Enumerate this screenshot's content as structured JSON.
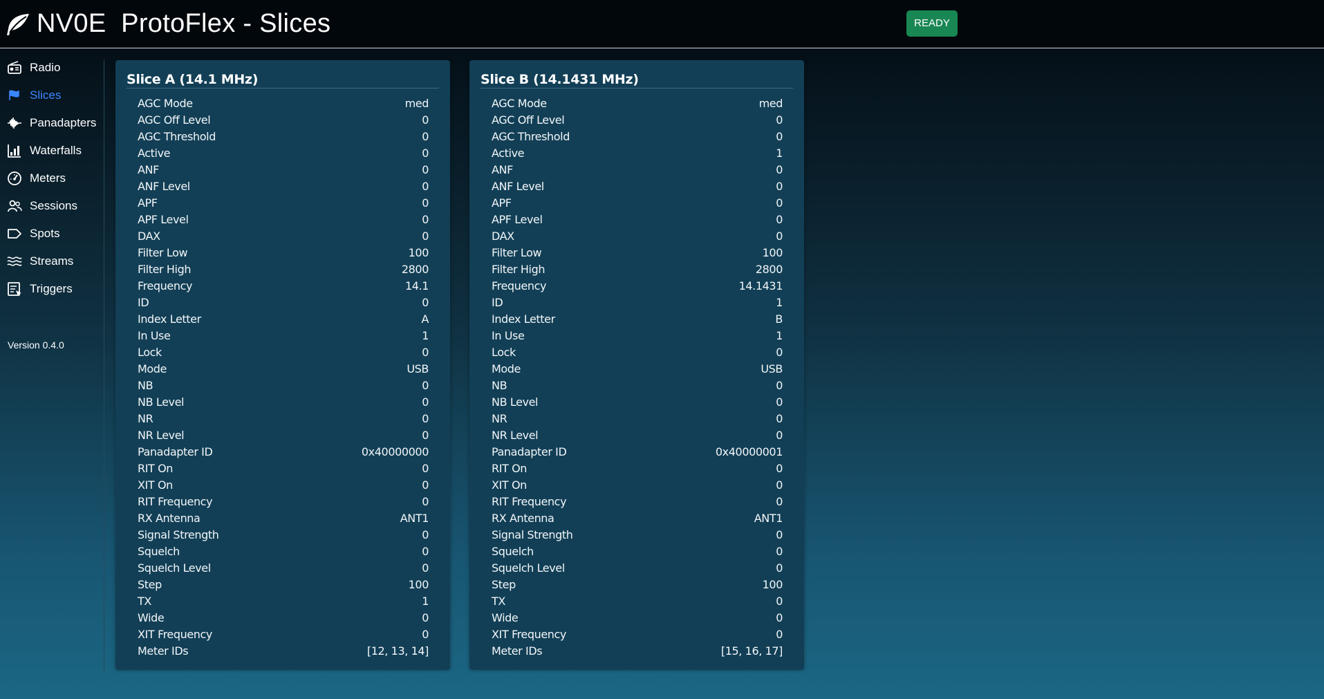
{
  "header": {
    "title": "NV0E  ProtoFlex - Slices",
    "status": "READY",
    "status_color": "#198754"
  },
  "sidebar": {
    "items": [
      {
        "label": "Radio",
        "icon": "radio-icon",
        "active": false
      },
      {
        "label": "Slices",
        "icon": "flag-icon",
        "active": true
      },
      {
        "label": "Panadapters",
        "icon": "waveform-icon",
        "active": false
      },
      {
        "label": "Waterfalls",
        "icon": "bar-chart-icon",
        "active": false
      },
      {
        "label": "Meters",
        "icon": "speedometer-icon",
        "active": false
      },
      {
        "label": "Sessions",
        "icon": "people-icon",
        "active": false
      },
      {
        "label": "Spots",
        "icon": "tag-icon",
        "active": false
      },
      {
        "label": "Streams",
        "icon": "water-icon",
        "active": false
      },
      {
        "label": "Triggers",
        "icon": "trigger-icon",
        "active": false
      }
    ],
    "version": "Version 0.4.0",
    "active_color": "#3a87ff"
  },
  "slices": [
    {
      "title": "Slice A (14.1 MHz)",
      "rows": [
        {
          "label": "AGC Mode",
          "value": "med"
        },
        {
          "label": "AGC Off Level",
          "value": "0"
        },
        {
          "label": "AGC Threshold",
          "value": "0"
        },
        {
          "label": "Active",
          "value": "0"
        },
        {
          "label": "ANF",
          "value": "0"
        },
        {
          "label": "ANF Level",
          "value": "0"
        },
        {
          "label": "APF",
          "value": "0"
        },
        {
          "label": "APF Level",
          "value": "0"
        },
        {
          "label": "DAX",
          "value": "0"
        },
        {
          "label": "Filter Low",
          "value": "100"
        },
        {
          "label": "Filter High",
          "value": "2800"
        },
        {
          "label": "Frequency",
          "value": "14.1"
        },
        {
          "label": "ID",
          "value": "0"
        },
        {
          "label": "Index Letter",
          "value": "A"
        },
        {
          "label": "In Use",
          "value": "1"
        },
        {
          "label": "Lock",
          "value": "0"
        },
        {
          "label": "Mode",
          "value": "USB"
        },
        {
          "label": "NB",
          "value": "0"
        },
        {
          "label": "NB Level",
          "value": "0"
        },
        {
          "label": "NR",
          "value": "0"
        },
        {
          "label": "NR Level",
          "value": "0"
        },
        {
          "label": "Panadapter ID",
          "value": "0x40000000"
        },
        {
          "label": "RIT On",
          "value": "0"
        },
        {
          "label": "XIT On",
          "value": "0"
        },
        {
          "label": "RIT Frequency",
          "value": "0"
        },
        {
          "label": "RX Antenna",
          "value": "ANT1"
        },
        {
          "label": "Signal Strength",
          "value": "0"
        },
        {
          "label": "Squelch",
          "value": "0"
        },
        {
          "label": "Squelch Level",
          "value": "0"
        },
        {
          "label": "Step",
          "value": "100"
        },
        {
          "label": "TX",
          "value": "1"
        },
        {
          "label": "Wide",
          "value": "0"
        },
        {
          "label": "XIT Frequency",
          "value": "0"
        },
        {
          "label": "Meter IDs",
          "value": "[12, 13, 14]"
        }
      ]
    },
    {
      "title": "Slice B (14.1431 MHz)",
      "rows": [
        {
          "label": "AGC Mode",
          "value": "med"
        },
        {
          "label": "AGC Off Level",
          "value": "0"
        },
        {
          "label": "AGC Threshold",
          "value": "0"
        },
        {
          "label": "Active",
          "value": "1"
        },
        {
          "label": "ANF",
          "value": "0"
        },
        {
          "label": "ANF Level",
          "value": "0"
        },
        {
          "label": "APF",
          "value": "0"
        },
        {
          "label": "APF Level",
          "value": "0"
        },
        {
          "label": "DAX",
          "value": "0"
        },
        {
          "label": "Filter Low",
          "value": "100"
        },
        {
          "label": "Filter High",
          "value": "2800"
        },
        {
          "label": "Frequency",
          "value": "14.1431"
        },
        {
          "label": "ID",
          "value": "1"
        },
        {
          "label": "Index Letter",
          "value": "B"
        },
        {
          "label": "In Use",
          "value": "1"
        },
        {
          "label": "Lock",
          "value": "0"
        },
        {
          "label": "Mode",
          "value": "USB"
        },
        {
          "label": "NB",
          "value": "0"
        },
        {
          "label": "NB Level",
          "value": "0"
        },
        {
          "label": "NR",
          "value": "0"
        },
        {
          "label": "NR Level",
          "value": "0"
        },
        {
          "label": "Panadapter ID",
          "value": "0x40000001"
        },
        {
          "label": "RIT On",
          "value": "0"
        },
        {
          "label": "XIT On",
          "value": "0"
        },
        {
          "label": "RIT Frequency",
          "value": "0"
        },
        {
          "label": "RX Antenna",
          "value": "ANT1"
        },
        {
          "label": "Signal Strength",
          "value": "0"
        },
        {
          "label": "Squelch",
          "value": "0"
        },
        {
          "label": "Squelch Level",
          "value": "0"
        },
        {
          "label": "Step",
          "value": "100"
        },
        {
          "label": "TX",
          "value": "0"
        },
        {
          "label": "Wide",
          "value": "0"
        },
        {
          "label": "XIT Frequency",
          "value": "0"
        },
        {
          "label": "Meter IDs",
          "value": "[15, 16, 17]"
        }
      ]
    }
  ]
}
